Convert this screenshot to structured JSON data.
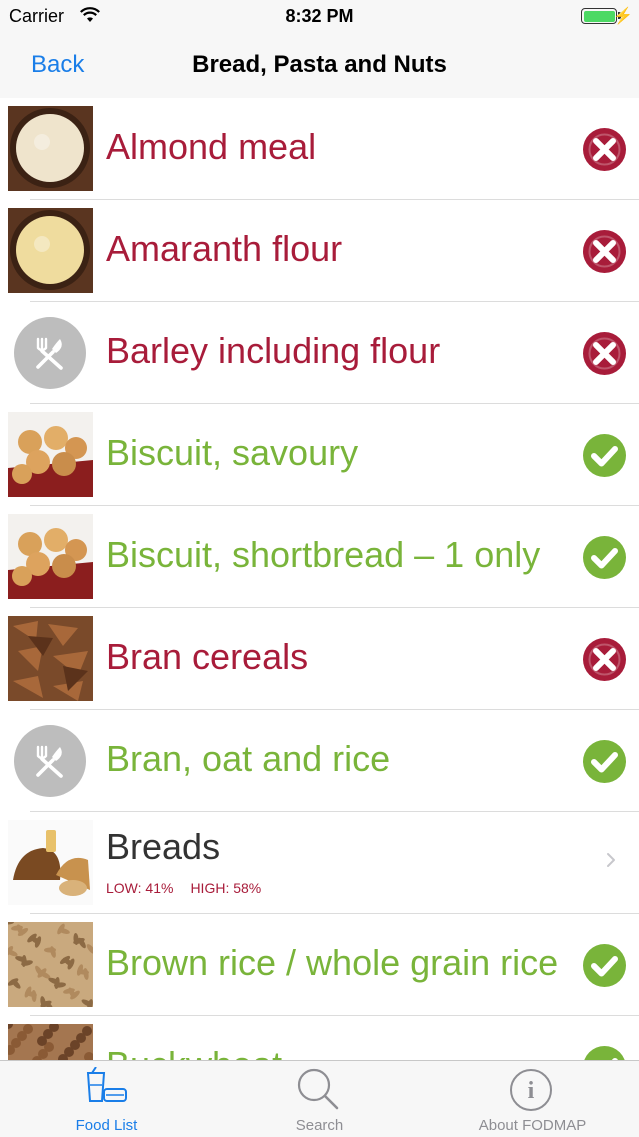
{
  "status_bar": {
    "carrier": "Carrier",
    "time": "8:32 PM"
  },
  "nav": {
    "back_label": "Back",
    "title": "Bread, Pasta and Nuts"
  },
  "foods": [
    {
      "name": "Almond meal",
      "status": "high",
      "thumb": "almond-meal-photo"
    },
    {
      "name": "Amaranth flour",
      "status": "high",
      "thumb": "amaranth-flour-photo"
    },
    {
      "name": "Barley including flour",
      "status": "high",
      "thumb": "utensils-icon"
    },
    {
      "name": "Biscuit, savoury",
      "status": "low",
      "thumb": "biscuit-photo"
    },
    {
      "name": "Biscuit, shortbread – 1 only",
      "status": "low",
      "thumb": "biscuit-photo"
    },
    {
      "name": "Bran cereals",
      "status": "high",
      "thumb": "bran-cereal-photo"
    },
    {
      "name": "Bran, oat and rice",
      "status": "low",
      "thumb": "utensils-icon"
    },
    {
      "name": "Breads",
      "status": "category",
      "thumb": "breads-photo",
      "low_stat": "LOW: 41%",
      "high_stat": "HIGH: 58%"
    },
    {
      "name": "Brown rice / whole grain rice",
      "status": "low",
      "thumb": "brown-rice-photo"
    },
    {
      "name": "Buckwheat",
      "status": "low",
      "thumb": "buckwheat-photo"
    }
  ],
  "tabs": [
    {
      "label": "Food List",
      "icon": "food-list-icon",
      "active": true
    },
    {
      "label": "Search",
      "icon": "search-icon",
      "active": false
    },
    {
      "label": "About FODMAP",
      "icon": "info-icon",
      "active": false
    }
  ],
  "colors": {
    "high": "#a81c3a",
    "low": "#79b43a",
    "accent": "#1a7ee8"
  }
}
